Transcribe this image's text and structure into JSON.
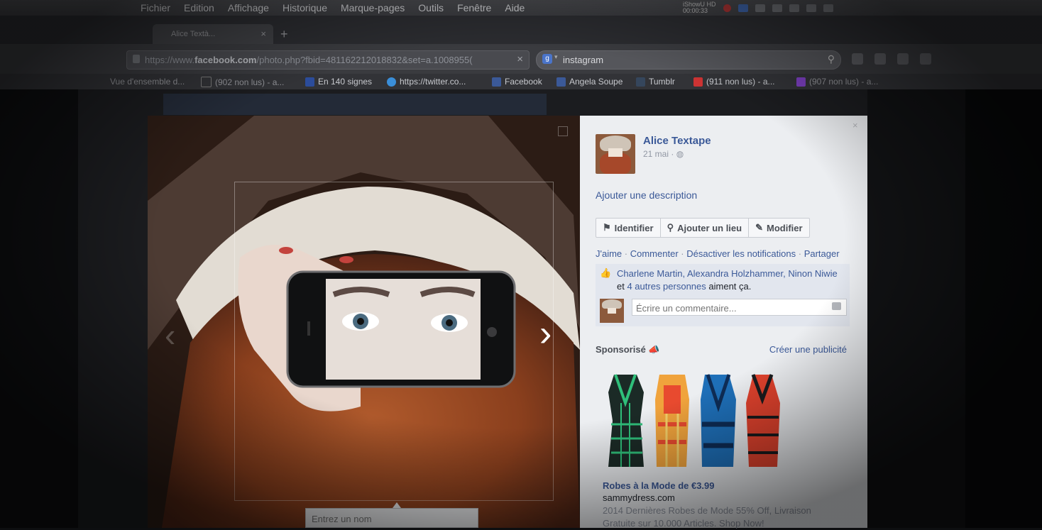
{
  "menubar": {
    "items": [
      "Fichier",
      "Edition",
      "Affichage",
      "Historique",
      "Marque-pages",
      "Outils",
      "Fenêtre",
      "Aide"
    ],
    "clock": "iShowU HD",
    "clock_time": "00:00:33"
  },
  "tab": {
    "title": "Alice Textà...",
    "close": "×",
    "new": "+"
  },
  "url": {
    "prefix": "https://www.",
    "domain": "facebook.com",
    "path": "/photo.php?fbid=481162212018832&set=a.1008955(",
    "clear": "×"
  },
  "search": {
    "engine": "g",
    "query": "instagram"
  },
  "bookmarks": [
    {
      "label": "Vue d'ensemble d...",
      "color": "#555"
    },
    {
      "label": "(902 non lus) - a...",
      "color": "#777"
    },
    {
      "label": "En 140 signes",
      "color": "#2b4c9b"
    },
    {
      "label": "https://twitter.co...",
      "color": "#3a8ed8"
    },
    {
      "label": "Facebook",
      "color": "#3b5998"
    },
    {
      "label": "Angela Soupe",
      "color": "#3b5998"
    },
    {
      "label": "Tumblr",
      "color": "#35465c"
    },
    {
      "label": "(911 non lus) - a...",
      "color": "#c33"
    },
    {
      "label": "(907 non lus) - a...",
      "color": "#7b3fbf"
    }
  ],
  "photo": {
    "tag_placeholder": "Entrez un nom",
    "prev": "‹",
    "next": "›"
  },
  "panel": {
    "close": "×",
    "author": "Alice Textape",
    "date": "21 mai · ",
    "add_description": "Ajouter une description",
    "actions": [
      {
        "icon": "tag-icon",
        "label": "Identifier"
      },
      {
        "icon": "location-pin-icon",
        "label": "Ajouter un lieu"
      },
      {
        "icon": "pencil-icon",
        "label": "Modifier"
      }
    ],
    "links": [
      "J'aime",
      "Commenter",
      "Désactiver les notifications",
      "Partager"
    ],
    "likes": {
      "names": "Charlene Martin, Alexandra Holzhammer, Ninon Niwie",
      "et": "et",
      "others": "4 autres personnes",
      "suffix": "aiment ça."
    },
    "comment_placeholder": "Écrire un commentaire...",
    "sponsored": "Sponsorisé",
    "create_ad": "Créer une publicité",
    "ad": {
      "title": "Robes à la Mode de €3.99",
      "domain": "sammydress.com",
      "description": "2014 Dernières Robes de Mode 55% Off, Livraison Gratuite sur 10.000 Articles. Shop Now!"
    }
  },
  "colors": {
    "facebook_blue": "#3b5998",
    "panel_bg": "#eceef1"
  }
}
